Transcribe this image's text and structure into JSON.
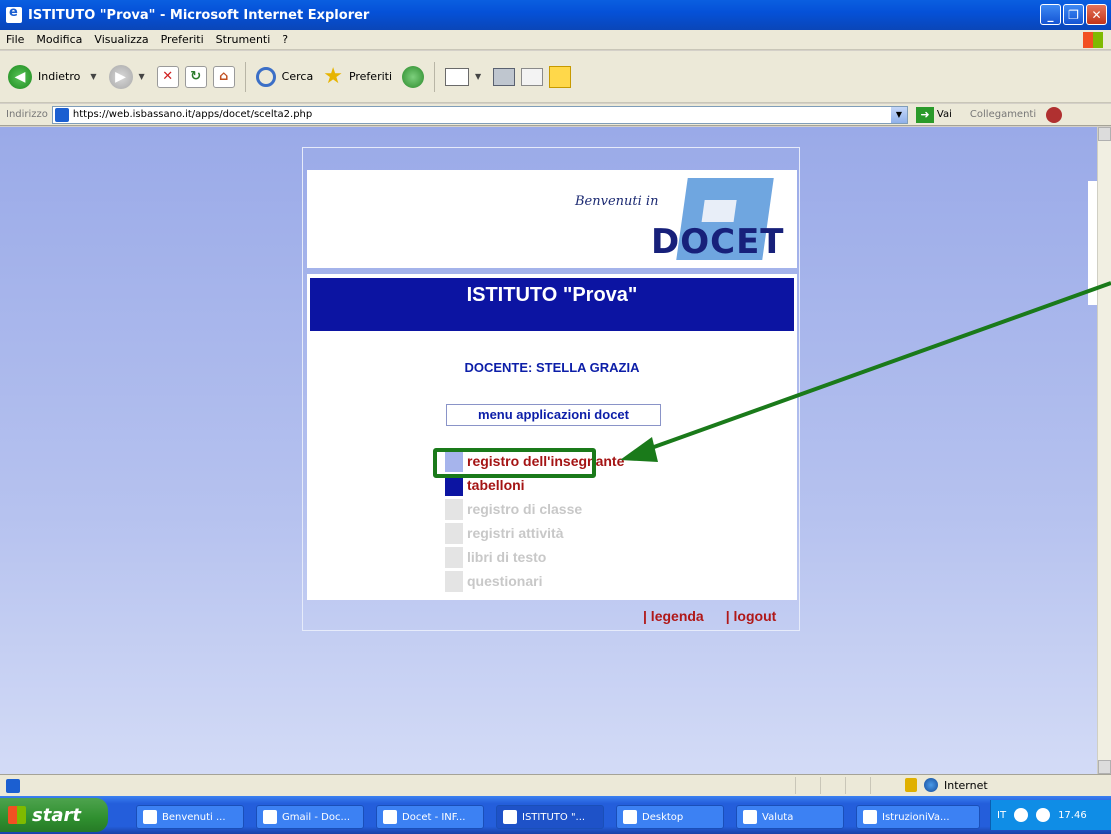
{
  "window": {
    "title": "ISTITUTO \"Prova\" - Microsoft Internet Explorer",
    "buttons": [
      "minimize-icon",
      "restore-icon",
      "close-icon"
    ]
  },
  "menubar": {
    "items": [
      "File",
      "Modifica",
      "Visualizza",
      "Preferiti",
      "Strumenti",
      "?"
    ]
  },
  "toolbar": {
    "back_label": "Indietro",
    "search_label": "Cerca",
    "favorites_label": "Preferiti"
  },
  "address": {
    "label": "Indirizzo",
    "url": "https://web.isbassano.it/apps/docet/scelta2.php",
    "go_label": "Vai",
    "links_label": "Collegamenti"
  },
  "page": {
    "welcome": "Benvenuti in",
    "logo_text": "DOCET",
    "institute": "ISTITUTO \"Prova\"",
    "teacher": "DOCENTE: STELLA GRAZIA",
    "menu_title": "menu applicazioni docet",
    "menu_items": [
      {
        "label": "registro dell'insegnante",
        "state": "active",
        "color": "#a6b4ec"
      },
      {
        "label": "tabelloni",
        "state": "active",
        "color": "#0c14a2"
      },
      {
        "label": "registro di classe",
        "state": "disabled"
      },
      {
        "label": "registri attività",
        "state": "disabled"
      },
      {
        "label": "libri di testo",
        "state": "disabled"
      },
      {
        "label": "questionari",
        "state": "disabled"
      }
    ],
    "footer_links": [
      "| legenda",
      "| logout"
    ]
  },
  "status": {
    "zone": "Internet"
  },
  "taskbar": {
    "start_label": "start",
    "tasks": [
      "Benvenuti ...",
      "Gmail - Doc...",
      "Docet - INF...",
      "ISTITUTO \"...",
      "Desktop",
      "Valuta",
      "IstruzioniVa..."
    ],
    "language": "IT",
    "clock": "17.46"
  },
  "colors": {
    "highlight": "#1a7a1a",
    "institute_bar": "#0c14a2",
    "link_red": "#a41414"
  }
}
